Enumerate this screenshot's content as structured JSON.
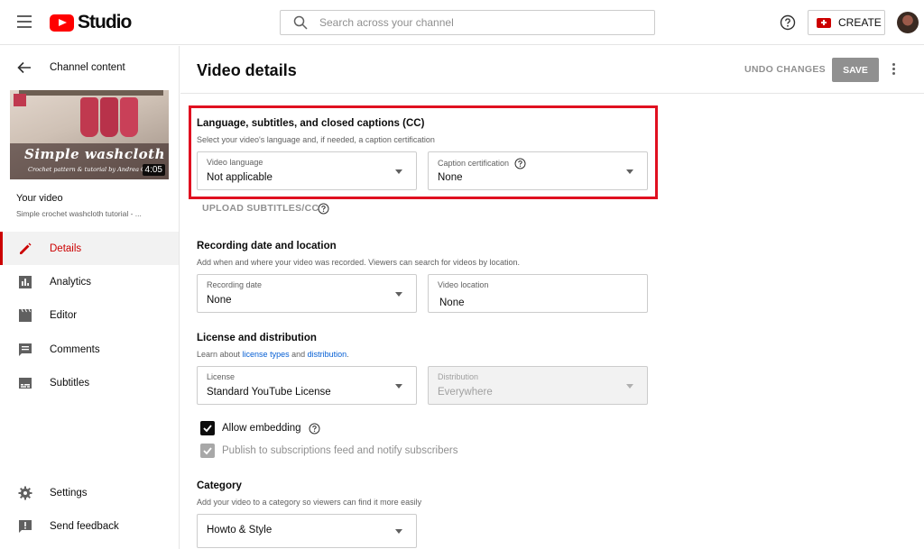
{
  "header": {
    "logo_text": "Studio",
    "search_placeholder": "Search across your channel",
    "create_label": "CREATE"
  },
  "sidebar": {
    "back_label": "Channel content",
    "thumbnail": {
      "title": "Simple washcloth",
      "subtitle": "Crochet pattern & tutorial by Andrea Cr",
      "duration": "4:05"
    },
    "your_video_label": "Your video",
    "video_title": "Simple crochet washcloth tutorial - ...",
    "nav": [
      {
        "label": "Details",
        "icon": "pencil-icon",
        "active": true
      },
      {
        "label": "Analytics",
        "icon": "analytics-icon",
        "active": false
      },
      {
        "label": "Editor",
        "icon": "clapperboard-icon",
        "active": false
      },
      {
        "label": "Comments",
        "icon": "comment-icon",
        "active": false
      },
      {
        "label": "Subtitles",
        "icon": "subtitles-icon",
        "active": false
      }
    ],
    "bottom_nav": [
      {
        "label": "Settings",
        "icon": "gear-icon"
      },
      {
        "label": "Send feedback",
        "icon": "feedback-icon"
      }
    ]
  },
  "main": {
    "title": "Video details",
    "undo_label": "UNDO CHANGES",
    "save_label": "SAVE",
    "language_section": {
      "title": "Language, subtitles, and closed captions (CC)",
      "desc": "Select your video's language and, if needed, a caption certification",
      "video_language": {
        "label": "Video language",
        "value": "Not applicable"
      },
      "caption_cert": {
        "label": "Caption certification",
        "value": "None"
      },
      "upload_label": "UPLOAD SUBTITLES/CC"
    },
    "recording_section": {
      "title": "Recording date and location",
      "desc": "Add when and where your video was recorded. Viewers can search for videos by location.",
      "recording_date": {
        "label": "Recording date",
        "value": "None"
      },
      "video_location": {
        "label": "Video location",
        "value": "None"
      }
    },
    "license_section": {
      "title": "License and distribution",
      "desc_prefix": "Learn about ",
      "link_license": "license types",
      "desc_and": " and ",
      "link_distribution": "distribution",
      "desc_suffix": ".",
      "license": {
        "label": "License",
        "value": "Standard YouTube License"
      },
      "distribution": {
        "label": "Distribution",
        "value": "Everywhere"
      },
      "allow_embedding": "Allow embedding",
      "publish_feed": "Publish to subscriptions feed and notify subscribers"
    },
    "category_section": {
      "title": "Category",
      "desc": "Add your video to a category so viewers can find it more easily",
      "value": "Howto & Style"
    }
  },
  "colors": {
    "brand_red": "#ff0000",
    "active_red": "#cc0000",
    "highlight": "#e01020",
    "link": "#065fd4"
  }
}
